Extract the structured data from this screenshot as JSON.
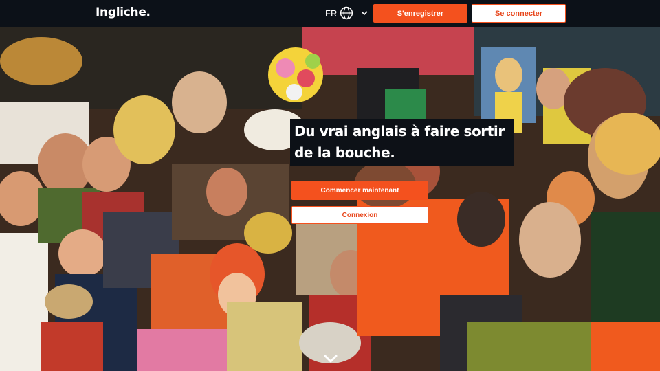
{
  "header": {
    "logo": "Ingliche.",
    "language": {
      "code": "FR",
      "icon": "globe-icon",
      "chevron": "chevron-down-icon"
    },
    "register_label": "S'enregistrer",
    "login_label": "Se connecter"
  },
  "hero": {
    "headline_line1": "Du vrai anglais à faire sortir",
    "headline_line2": "de la bouche.",
    "cta_start_label": "Commencer maintenant",
    "cta_login_label": "Connexion",
    "scroll_icon": "chevron-down-icon",
    "background": "retro-collage-image"
  },
  "colors": {
    "accent": "#f4511e",
    "topbar": "#0c1118",
    "headline_bg": "#0d1117",
    "white": "#ffffff"
  }
}
